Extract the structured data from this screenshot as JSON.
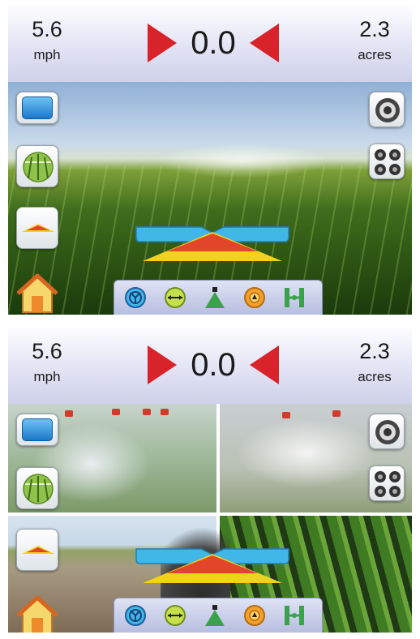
{
  "screens": [
    {
      "header": {
        "left_value": "5.6",
        "left_unit": "mph",
        "center_value": "0.0",
        "right_value": "2.3",
        "right_unit": "acres"
      },
      "view": "single-camera"
    },
    {
      "header": {
        "left_value": "5.6",
        "left_unit": "mph",
        "center_value": "0.0",
        "right_value": "2.3",
        "right_unit": "acres"
      },
      "view": "quad-camera"
    }
  ],
  "colors": {
    "arrow_red": "#d9232b",
    "header_light": "#fdfdff",
    "header_dark": "#cfd1ea",
    "lightbar_blue": "#41b7e8",
    "boom_yellow": "#f2d21c",
    "boom_red": "#e2452a",
    "icon_green": "#3aa24a",
    "icon_orange": "#f2a22a"
  },
  "icons": {
    "left_column": [
      "screen-select-icon",
      "guidance-view-icon",
      "boom-view-icon",
      "home-icon"
    ],
    "right_column": [
      "speaker-icon",
      "camera-grid-icon"
    ],
    "toolbar": [
      "steering-icon",
      "swath-width-icon",
      "nozzle-icon",
      "boom-height-icon",
      "boom-sections-icon"
    ]
  }
}
